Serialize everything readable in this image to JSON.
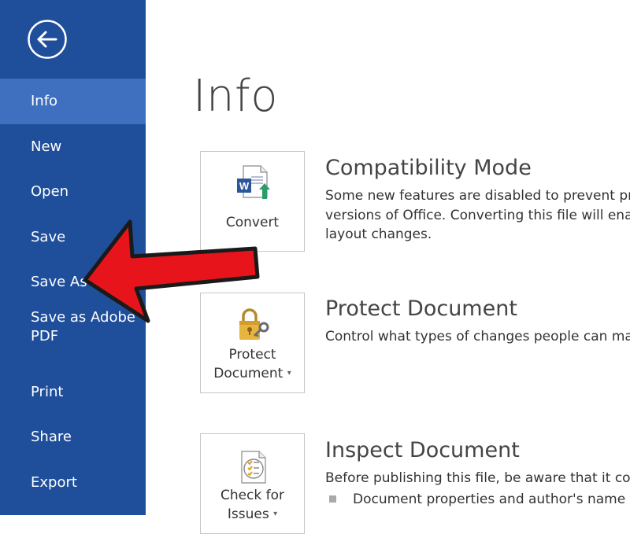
{
  "sidebar": {
    "background": "#1f4e9b",
    "active_background": "#3f6fbf",
    "back_icon": "back-arrow-icon",
    "items": [
      {
        "label": "Info",
        "active": true
      },
      {
        "label": "New"
      },
      {
        "label": "Open"
      },
      {
        "label": "Save"
      },
      {
        "label": "Save As"
      },
      {
        "label": "Save as Adobe\nPDF"
      },
      {
        "label": "Print"
      },
      {
        "label": "Share"
      },
      {
        "label": "Export"
      }
    ]
  },
  "main": {
    "title": "Info",
    "sections": [
      {
        "button_label": "Convert",
        "icon": "word-convert-icon",
        "heading": "Compatibility Mode",
        "description": [
          "Some new features are disabled to prevent proble",
          "versions of Office. Converting this file will enable",
          "layout changes."
        ]
      },
      {
        "button_label_line1": "Protect",
        "button_label_line2": "Document",
        "icon": "lock-key-icon",
        "heading": "Protect Document",
        "description": [
          "Control what types of changes people can make"
        ]
      },
      {
        "button_label_line1": "Check for",
        "button_label_line2": "Issues",
        "icon": "checklist-icon",
        "heading": "Inspect Document",
        "description": [
          "Before publishing this file, be aware that it contai"
        ],
        "bullets": [
          "Document properties and author's name"
        ]
      }
    ]
  },
  "annotation": {
    "icon": "red-arrow-pointer",
    "color": "#e8141b"
  }
}
